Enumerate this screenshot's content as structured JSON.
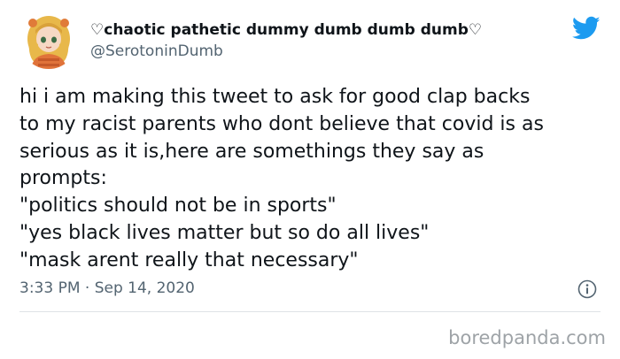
{
  "author": {
    "display_name": "♡chaotic pathetic dummy dumb dumb dumb♡",
    "handle": "@SerotoninDumb",
    "avatar": "cartoon-avatar"
  },
  "brand": {
    "icon": "twitter-bird-icon",
    "color": "#1d9bf0"
  },
  "tweet": {
    "lines": [
      "hi i am making this tweet to ask for good clap backs",
      "to my racist parents who dont believe that covid is as",
      "serious as it is,here are somethings they say as",
      "prompts:",
      "\"politics should not be in sports\"",
      "\"yes black lives matter but so do all lives\"",
      "\"mask arent really that necessary\""
    ],
    "timestamp": "3:33 PM · Sep 14, 2020"
  },
  "info_icon": "info-icon",
  "watermark": "boredpanda.com"
}
